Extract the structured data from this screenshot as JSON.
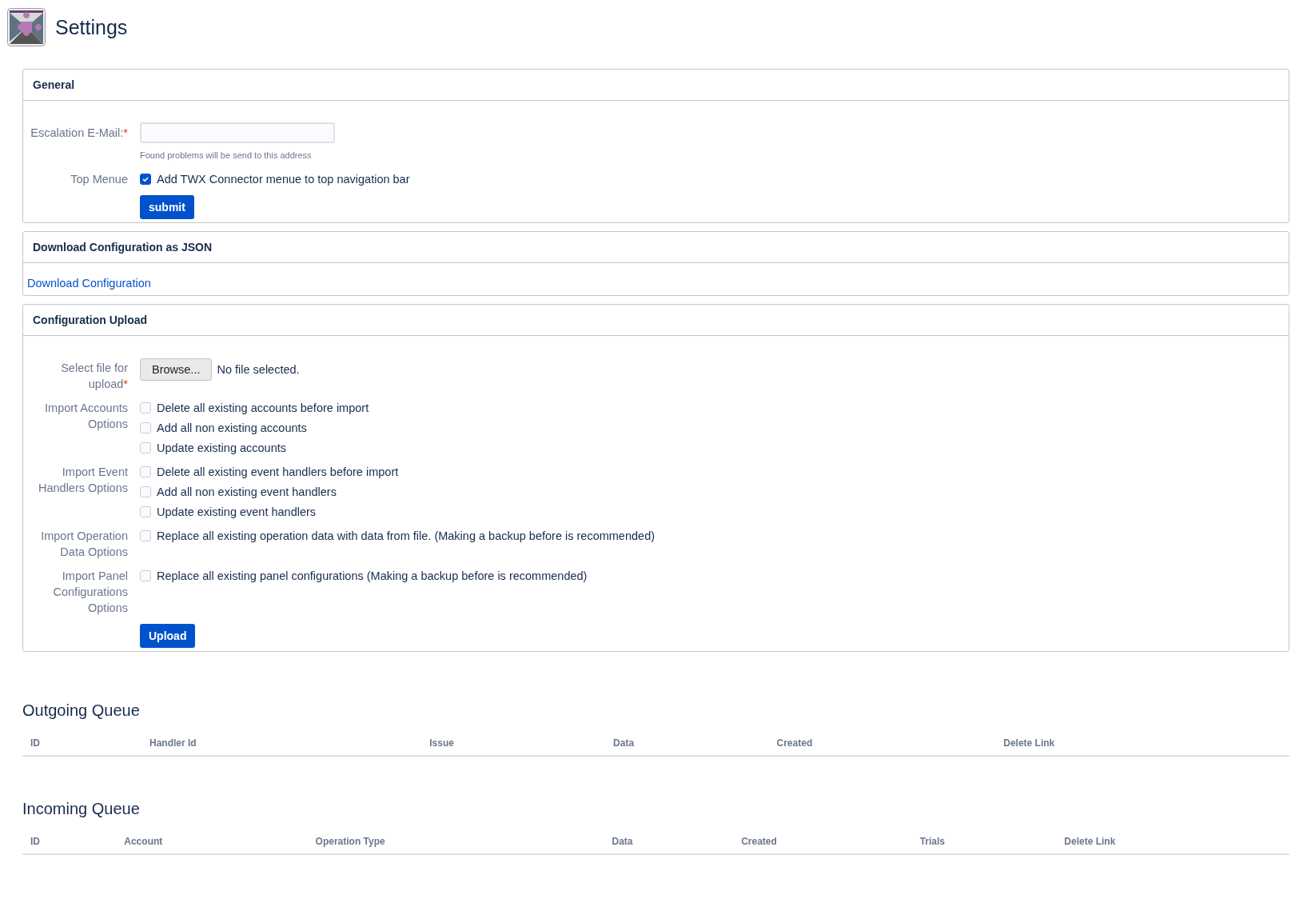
{
  "page": {
    "title": "Settings"
  },
  "general": {
    "title": "General",
    "fields": [
      {
        "kind": "email",
        "label": "Escalation E-Mail:",
        "required_mark": "*",
        "hint": "Found problems will be send to this address"
      },
      {
        "kind": "checkboxes",
        "label": "Top Menue",
        "options": [
          {
            "label": "Add TWX Connector menue to top navigation bar",
            "checked": true
          }
        ]
      }
    ],
    "button": "submit"
  },
  "download": {
    "title": "Download Configuration as JSON",
    "link": "Download Configuration"
  },
  "upload": {
    "title": "Configuration Upload",
    "fields": [
      {
        "kind": "file",
        "label": "Select file for upload",
        "required_mark": "*",
        "button": "Browse...",
        "status": "No file selected."
      },
      {
        "kind": "checkboxes",
        "label": "Import Accounts Options",
        "options": [
          {
            "label": "Delete all existing accounts before import",
            "checked": false
          },
          {
            "label": "Add all non existing accounts",
            "checked": false
          },
          {
            "label": "Update existing accounts",
            "checked": false
          }
        ]
      },
      {
        "kind": "checkboxes",
        "label": "Import Event Handlers Options",
        "options": [
          {
            "label": "Delete all existing event handlers before import",
            "checked": false
          },
          {
            "label": "Add all non existing event handlers",
            "checked": false
          },
          {
            "label": "Update existing event handlers",
            "checked": false
          }
        ]
      },
      {
        "kind": "checkboxes",
        "label": "Import Operation Data Options",
        "options": [
          {
            "label": "Replace all existing operation data with data from file. (Making a backup before is recommended)",
            "checked": false
          }
        ]
      },
      {
        "kind": "checkboxes",
        "label": "Import Panel Configurations Options",
        "options": [
          {
            "label": "Replace all existing panel configurations (Making a backup before is recommended)",
            "checked": false
          }
        ]
      }
    ],
    "button": "Upload"
  },
  "queues": [
    {
      "title": "Outgoing Queue",
      "columns": [
        "ID",
        "Handler Id",
        "Issue",
        "Data",
        "Created",
        "Delete Link"
      ]
    },
    {
      "title": "Incoming Queue",
      "columns": [
        "ID",
        "Account",
        "Operation Type",
        "Data",
        "Created",
        "Trials",
        "Delete Link"
      ]
    }
  ]
}
